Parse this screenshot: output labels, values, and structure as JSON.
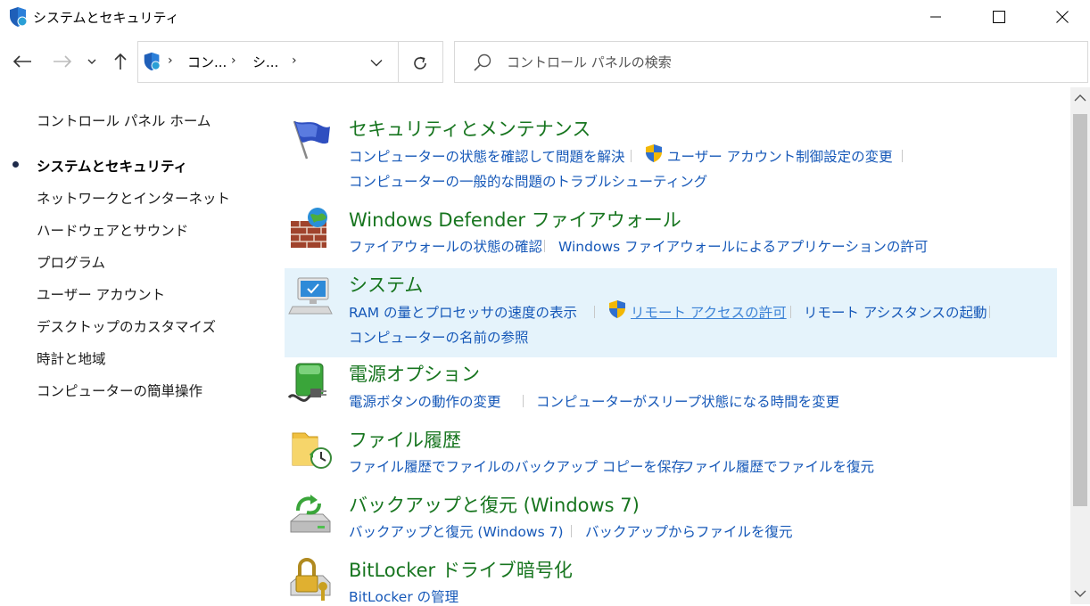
{
  "window": {
    "title": "システムとセキュリティ",
    "minimize_icon": "minimize-icon",
    "maximize_icon": "maximize-icon",
    "close_icon": "close-icon"
  },
  "nav": {
    "breadcrumbs": [
      "コン...",
      "シ..."
    ],
    "search_placeholder": "コントロール パネルの検索"
  },
  "sidebar": {
    "items": [
      {
        "label": "コントロール パネル ホーム",
        "active": false
      },
      {
        "label": "システムとセキュリティ",
        "active": true
      },
      {
        "label": "ネットワークとインターネット",
        "active": false
      },
      {
        "label": "ハードウェアとサウンド",
        "active": false
      },
      {
        "label": "プログラム",
        "active": false
      },
      {
        "label": "ユーザー アカウント",
        "active": false
      },
      {
        "label": "デスクトップのカスタマイズ",
        "active": false
      },
      {
        "label": "時計と地域",
        "active": false
      },
      {
        "label": "コンピューターの簡単操作",
        "active": false
      }
    ]
  },
  "categories": [
    {
      "title": "セキュリティとメンテナンス",
      "icon": "flag-icon",
      "links": [
        "コンピューターの状態を確認して問題を解決",
        "ユーザー アカウント制御設定の変更",
        "コンピューターの一般的な問題のトラブルシューティング"
      ]
    },
    {
      "title": "Windows Defender ファイアウォール",
      "icon": "firewall-icon",
      "links": [
        "ファイアウォールの状態の確認",
        "Windows ファイアウォールによるアプリケーションの許可"
      ]
    },
    {
      "title": "システム",
      "icon": "computer-icon",
      "highlighted": true,
      "links": [
        "RAM の量とプロセッサの速度の表示",
        "リモート アクセスの許可",
        "リモート アシスタンスの起動",
        "コンピューターの名前の参照"
      ]
    },
    {
      "title": "電源オプション",
      "icon": "battery-icon",
      "links": [
        "電源ボタンの動作の変更",
        "コンピューターがスリープ状態になる時間を変更"
      ]
    },
    {
      "title": "ファイル履歴",
      "icon": "file-history-icon",
      "links": [
        "ファイル履歴でファイルのバックアップ コピーを保存",
        "ファイル履歴でファイルを復元"
      ]
    },
    {
      "title": "バックアップと復元 (Windows 7)",
      "icon": "backup-icon",
      "links": [
        "バックアップと復元 (Windows 7)",
        "バックアップからファイルを復元"
      ]
    },
    {
      "title": "BitLocker ドライブ暗号化",
      "icon": "bitlocker-icon",
      "links": [
        "BitLocker の管理"
      ]
    }
  ],
  "colors": {
    "title_green": "#17751f",
    "link_blue": "#1658b8",
    "highlight": "#e5f3fb"
  }
}
